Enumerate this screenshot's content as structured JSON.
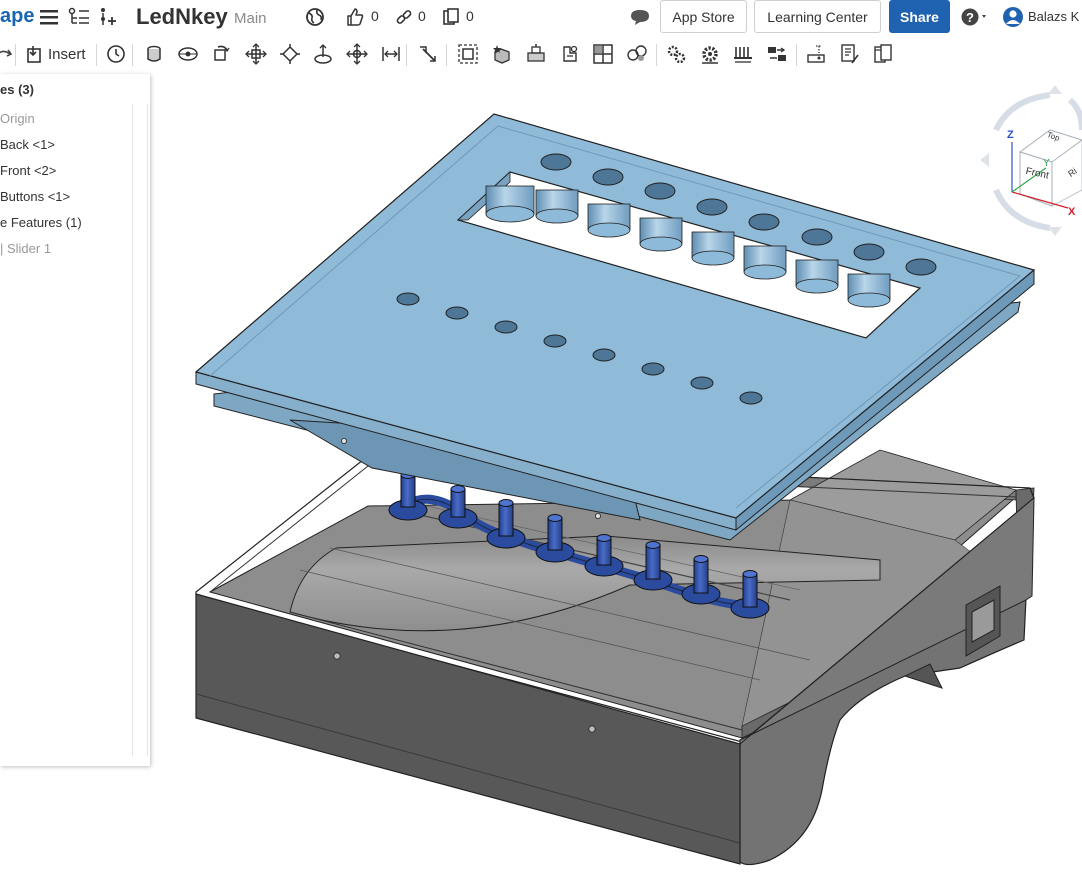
{
  "header": {
    "logo_text": "ape",
    "doc_title": "LedNkey",
    "branch": "Main",
    "likes": "0",
    "links": "0",
    "copies": "0",
    "app_store": "App Store",
    "learning_center": "Learning Center",
    "share": "Share",
    "user_name": "Balazs K",
    "accent": "#1f63b0"
  },
  "toolbar": {
    "insert_label": "Insert"
  },
  "panel": {
    "heading": "es (3)",
    "items": [
      {
        "label": "Origin",
        "dim": true
      },
      {
        "label": "Back <1>",
        "dim": false
      },
      {
        "label": "Front <2>",
        "dim": false
      },
      {
        "label": "Buttons <1>",
        "dim": false
      },
      {
        "label": "e Features (1)",
        "dim": false
      },
      {
        "label": "| Slider 1",
        "dim": true
      }
    ]
  },
  "view_cube": {
    "axis_z": "Z",
    "axis_y": "Y",
    "axis_x": "X",
    "face_top": "Top",
    "face_front": "Front",
    "face_right": "Ri"
  }
}
